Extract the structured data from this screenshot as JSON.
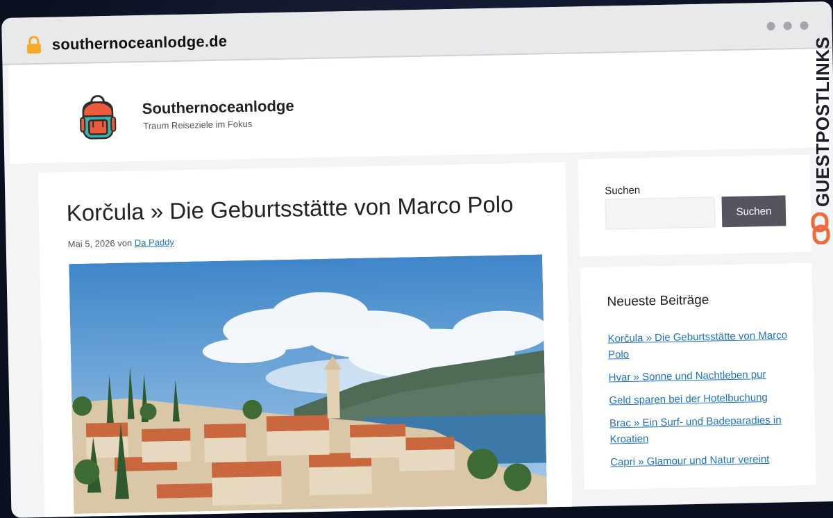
{
  "browser": {
    "url": "southernoceanlodge.de"
  },
  "site": {
    "title": "Southernoceanlodge",
    "tagline": "Traum Reiseziele im Fokus"
  },
  "post": {
    "title": "Korčula » Die Geburtsstätte von Marco Polo",
    "date": "Mai 5, 2026",
    "by": "von",
    "author": "Da Paddy"
  },
  "sidebar": {
    "search": {
      "label": "Suchen",
      "button": "Suchen",
      "value": ""
    },
    "recent": {
      "title": "Neueste Beiträge",
      "items": [
        "Korčula » Die Geburtsstätte von Marco Polo",
        "Hvar » Sonne und Nachtleben pur",
        "Geld sparen bei der Hotelbuchung",
        "Brac » Ein Surf- und Badeparadies in Kroatien",
        "Capri » Glamour und Natur vereint"
      ]
    }
  },
  "watermark": {
    "text": "GUESTPOSTLINKS",
    "accent": "#ef6a3a"
  }
}
